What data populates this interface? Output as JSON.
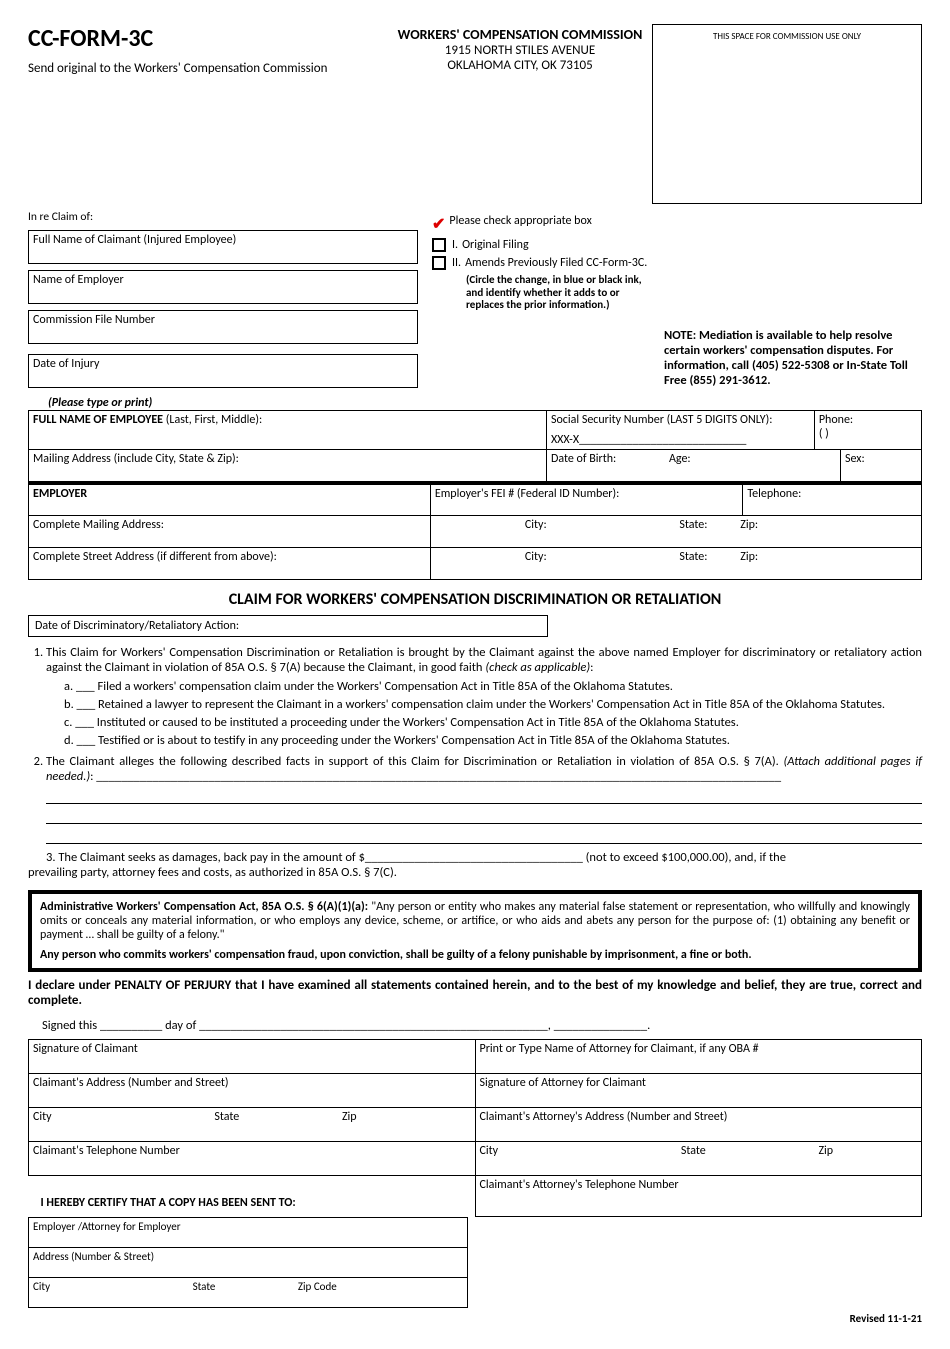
{
  "header": {
    "form_code": "CC-FORM-3C",
    "title": "WORKERS' COMPENSATION COMMISSION",
    "addr1": "1915 NORTH STILES AVENUE",
    "addr2": "OKLAHOMA CITY, OK  73105",
    "send_original": "Send original to the Workers' Compensation Commission",
    "commission_box": "THIS SPACE FOR COMMISSION USE ONLY"
  },
  "claim_fields": {
    "in_re": "In re Claim of:",
    "claimant_name": "Full Name of Claimant (Injured Employee)",
    "employer_name": "Name of Employer",
    "file_no": "Commission File Number",
    "date_injury": "Date of Injury"
  },
  "checkboxes": {
    "instruction": "Please check appropriate box",
    "opt1_num": "I.",
    "opt1": "Original Filing",
    "opt2_num": "II.",
    "opt2": "Amends Previously Filed CC-Form-3C.",
    "opt2_detail": "(Circle the change, in blue or black ink, and identify whether it adds to or replaces the prior information.)"
  },
  "note": "NOTE: Mediation is available to help resolve certain workers' compensation disputes. For information, call (405) 522-5308 or In-State Toll Free (855) 291-3612.",
  "please_type": "(Please type or print)",
  "employee": {
    "name_label": "FULL NAME OF EMPLOYEE",
    "name_suffix": " (Last, First, Middle):",
    "ssn_label": "Social Security Number (LAST 5 DIGITS ONLY):",
    "ssn_prefix": "XXX-X",
    "phone_label": "Phone:",
    "phone_paren": "(          )",
    "mail_label": "Mailing Address (include City, State & Zip):",
    "dob_label": "Date of Birth:",
    "age_label": "Age:",
    "sex_label": "Sex:"
  },
  "employer": {
    "heading": "EMPLOYER",
    "fei_label": "Employer's FEI # (Federal ID Number):",
    "tel_label": "Telephone:",
    "mail_label": "Complete Mailing Address:",
    "city_label": "City:",
    "state_label": "State:",
    "zip_label": "Zip:",
    "street_label": "Complete Street Address (if different from above):"
  },
  "section_title": "CLAIM FOR WORKERS' COMPENSATION DISCRIMINATION OR RETALIATION",
  "date_action_label": "Date of Discriminatory/Retaliatory Action:",
  "para1_intro": "This Claim for Workers' Compensation Discrimination or Retaliation is brought by the Claimant against the above named Employer for discriminatory or retaliatory action against the Claimant in violation of 85A O.S. § 7(A) because the Claimant, in good faith ",
  "para1_italic": "(check as applicable)",
  "para1_colon": ":",
  "sub": {
    "a": "a. ___   Filed a workers' compensation claim under the Workers' Compensation Act in Title 85A of the Oklahoma Statutes.",
    "b": "b. ___   Retained a lawyer to represent the Claimant in a workers' compensation claim under the Workers' Compensation Act in Title 85A of the Oklahoma Statutes.",
    "c": "c. ___   Instituted or caused to be instituted a proceeding under the Workers' Compensation Act in Title 85A of the Oklahoma Statutes.",
    "d": "d. ___   Testified or is about to testify in any proceeding under the Workers' Compensation Act in Title 85A of the Oklahoma Statutes."
  },
  "para2_intro": "The Claimant alleges the following described facts in support of this Claim for Discrimination or Retaliation in violation of 85A O.S. § 7(A).  ",
  "para2_italic": "(Attach additional pages if needed.)",
  "para2_colon": ": ______________________________________________________________________________________________________________",
  "para3_a": "3. The Claimant seeks as damages, back pay in the amount of $___________________________________ (not to exceed $100,000.00), and, if the",
  "para3_b": "prevailing party, attorney fees and costs, as authorized in 85A O.S. § 7(C).",
  "warn": {
    "lead": "Administrative Workers' Compensation Act, 85A O.S. § 6(A)(1)(a):",
    "body": "  \"Any person or entity who makes any material false statement or representation, who willfully and knowingly omits or conceals any material information, or who employs any device, scheme, or  artifice, or who aids and abets any person for the purpose of: (1) obtaining any benefit or payment … shall be guilty of a felony.\"",
    "fraud": "Any person who commits workers' compensation fraud, upon conviction, shall be guilty of a felony punishable by imprisonment, a fine or both."
  },
  "perjury": "I declare under PENALTY OF PERJURY that I have examined all statements contained herein, and to the best of my knowledge and belief, they are true, correct and complete.",
  "signed": "Signed this __________ day of ________________________________________________________, _______________.",
  "sig": {
    "claimant_sig": "Signature of Claimant",
    "attorney_name": "Print or Type Name of Attorney for Claimant, if any OBA #",
    "claimant_addr": "Claimant's Address (Number and Street)",
    "attorney_sig": "Signature of Attorney for Claimant",
    "city": "City",
    "state": "State",
    "zip": "Zip",
    "claimant_phone": "Claimant's Telephone Number",
    "atty_addr": "Claimant's Attorney's Address (Number and Street)",
    "atty_phone": "Claimant's Attorney's Telephone Number"
  },
  "cert_heading": "I HEREBY CERTIFY THAT A COPY HAS BEEN SENT TO:",
  "copy": {
    "emp_atty": "Employer /Attorney for Employer",
    "addr": "Address (Number & Street)",
    "city": "City",
    "state": "State",
    "zip": "Zip Code"
  },
  "revised": "Revised 11-1-21"
}
